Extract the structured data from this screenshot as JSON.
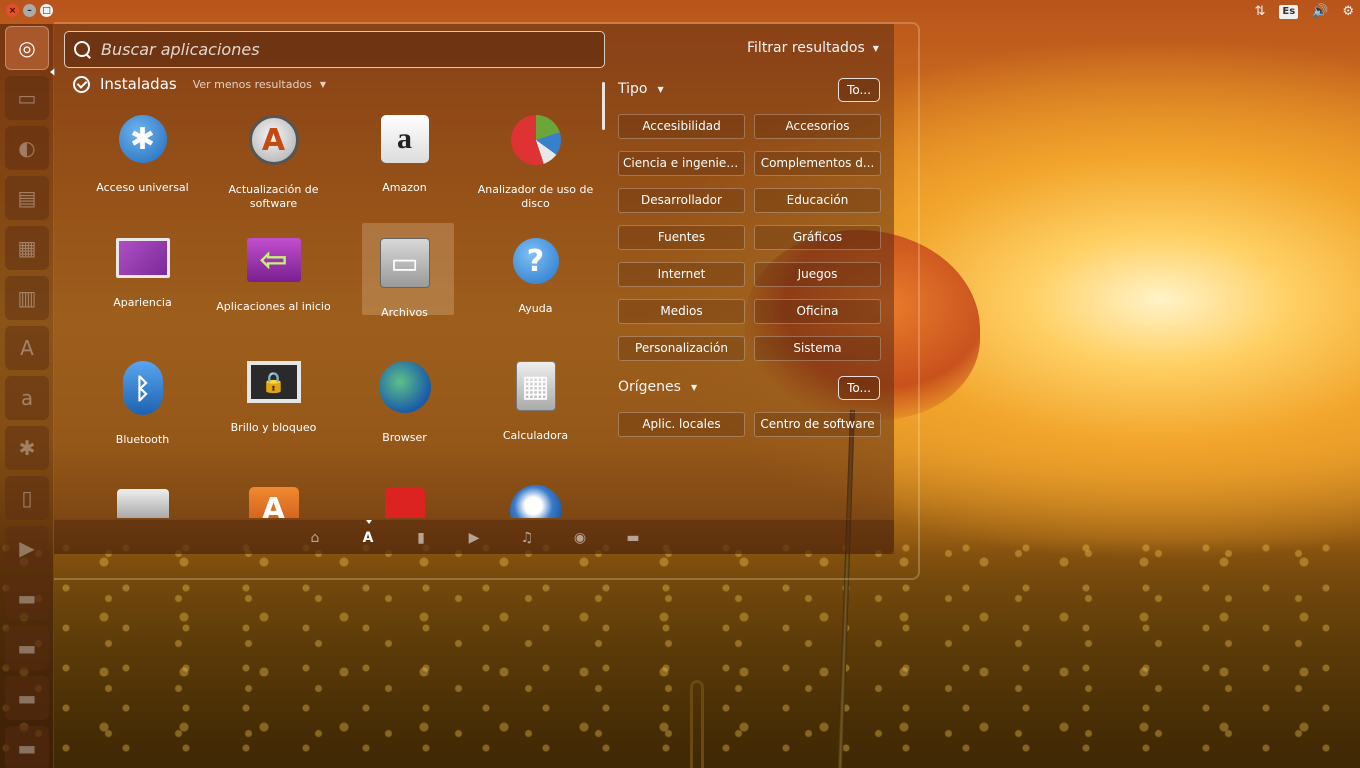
{
  "top_panel": {
    "window_controls": {
      "close": "×",
      "minimize": "–",
      "maximize": "□"
    },
    "indicators": {
      "network_icon": "⇅",
      "keyboard_layout": "Es",
      "volume_icon": "🔊",
      "settings_icon": "⚙"
    }
  },
  "launcher": {
    "items": [
      {
        "name": "dash-home",
        "glyph": "◎"
      },
      {
        "name": "files",
        "glyph": "▭"
      },
      {
        "name": "firefox",
        "glyph": "◐"
      },
      {
        "name": "writer",
        "glyph": "▤"
      },
      {
        "name": "calc",
        "glyph": "▦"
      },
      {
        "name": "impress",
        "glyph": "▥"
      },
      {
        "name": "software-center",
        "glyph": "A"
      },
      {
        "name": "amazon",
        "glyph": "a"
      },
      {
        "name": "system-settings",
        "glyph": "✱"
      },
      {
        "name": "workspace",
        "glyph": "▯"
      },
      {
        "name": "video",
        "glyph": "▶"
      },
      {
        "name": "drive-1",
        "glyph": "▬"
      },
      {
        "name": "drive-2",
        "glyph": "▬"
      },
      {
        "name": "drive-3",
        "glyph": "▬"
      },
      {
        "name": "trash",
        "glyph": "▬"
      }
    ]
  },
  "dash": {
    "search": {
      "placeholder": "Buscar aplicaciones",
      "value": ""
    },
    "filter_toggle": "Filtrar resultados",
    "category": {
      "title": "Instaladas",
      "more_label": "Ver menos resultados"
    },
    "apps": [
      {
        "label": "Acceso universal",
        "icon": "accessibility-icon",
        "glyph": "✱"
      },
      {
        "label": "Actualización de software",
        "icon": "software-update-icon",
        "glyph": "A"
      },
      {
        "label": "Amazon",
        "icon": "amazon-icon",
        "glyph": "a"
      },
      {
        "label": "Analizador de uso de disco",
        "icon": "disk-usage-icon",
        "glyph": ""
      },
      {
        "label": "Apariencia",
        "icon": "appearance-icon",
        "glyph": ""
      },
      {
        "label": "Aplicaciones al inicio",
        "icon": "startup-apps-icon",
        "glyph": "⇦"
      },
      {
        "label": "Archivos",
        "icon": "files-icon",
        "glyph": "▭"
      },
      {
        "label": "Ayuda",
        "icon": "help-icon",
        "glyph": "?"
      },
      {
        "label": "Bluetooth",
        "icon": "bluetooth-icon",
        "glyph": "ᛒ"
      },
      {
        "label": "Brillo y bloqueo",
        "icon": "brightness-lock-icon",
        "glyph": "🔒"
      },
      {
        "label": "Browser",
        "icon": "browser-icon",
        "glyph": ""
      },
      {
        "label": "Calculadora",
        "icon": "calculator-icon",
        "glyph": "▦"
      },
      {
        "label": "",
        "icon": "camera-icon",
        "glyph": ""
      },
      {
        "label": "",
        "icon": "shop-icon",
        "glyph": "A"
      },
      {
        "label": "",
        "icon": "joystick-icon",
        "glyph": ""
      },
      {
        "label": "",
        "icon": "thunderbird-icon",
        "glyph": ""
      }
    ],
    "lenses": [
      {
        "name": "home",
        "glyph": "⌂"
      },
      {
        "name": "applications",
        "glyph": "A"
      },
      {
        "name": "files",
        "glyph": "▮"
      },
      {
        "name": "video",
        "glyph": "▶"
      },
      {
        "name": "music",
        "glyph": "♫"
      },
      {
        "name": "photos",
        "glyph": "◉"
      },
      {
        "name": "social",
        "glyph": "▬"
      }
    ]
  },
  "filters": {
    "type": {
      "title": "Tipo",
      "all_label": "To...",
      "options": [
        "Accesibilidad",
        "Accesorios",
        "Ciencia e ingeniería",
        "Complementos d...",
        "Desarrollador",
        "Educación",
        "Fuentes",
        "Gráficos",
        "Internet",
        "Juegos",
        "Medios",
        "Oficina",
        "Personalización",
        "Sistema"
      ]
    },
    "sources": {
      "title": "Orígenes",
      "all_label": "To...",
      "options": [
        "Aplic. locales",
        "Centro de software"
      ]
    }
  }
}
